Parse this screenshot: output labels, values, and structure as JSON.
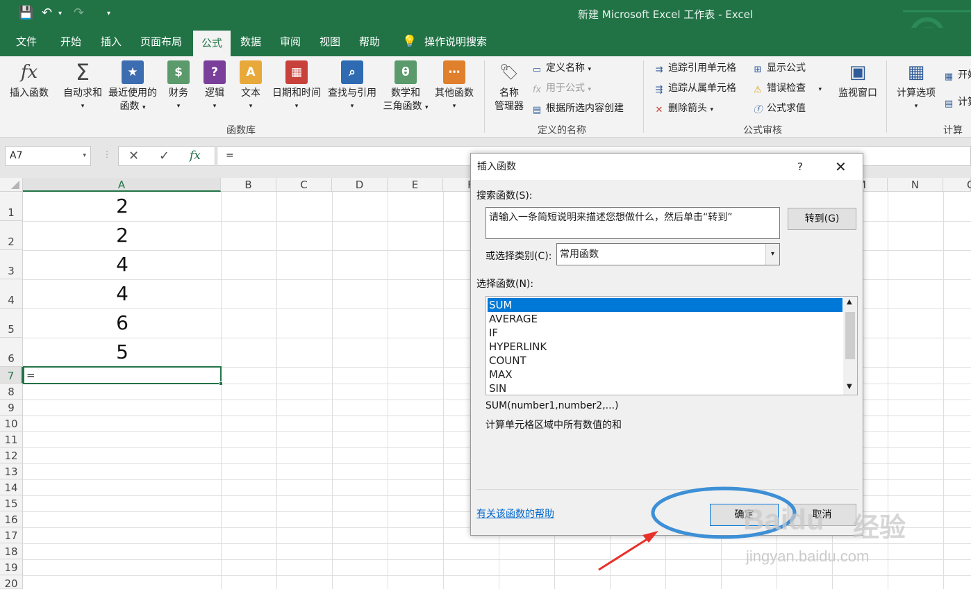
{
  "window": {
    "title": "新建 Microsoft Excel 工作表 - Excel"
  },
  "tabs": [
    "文件",
    "开始",
    "插入",
    "页面布局",
    "公式",
    "数据",
    "审阅",
    "视图",
    "帮助"
  ],
  "tell_me": "操作说明搜索",
  "ribbon": {
    "insert_function": "插入函数",
    "autosum": "自动求和",
    "recent": "最近使用的",
    "recent2": "函数",
    "financial": "财务",
    "logical": "逻辑",
    "text": "文本",
    "datetime": "日期和时间",
    "lookup": "查找与引用",
    "math": "数学和",
    "math2": "三角函数",
    "more": "其他函数",
    "group_library": "函数库",
    "name_mgr": "名称",
    "name_mgr2": "管理器",
    "define_name": "定义名称",
    "use_in_formula": "用于公式",
    "create_from_sel": "根据所选内容创建",
    "group_names": "定义的名称",
    "trace_precedents": "追踪引用单元格",
    "trace_dependents": "追踪从属单元格",
    "remove_arrows": "删除箭头",
    "show_formulas": "显示公式",
    "error_check": "错误检查",
    "evaluate": "公式求值",
    "watch": "监视窗口",
    "group_audit": "公式审核",
    "calc_options": "计算选项",
    "calc_now": "开始",
    "calc_sheet": "计算",
    "group_calc": "计算"
  },
  "formula_bar": {
    "name_box": "A7",
    "content": "="
  },
  "columns": [
    "A",
    "B",
    "C",
    "D",
    "E",
    "F",
    "M",
    "N",
    "O"
  ],
  "rows": [
    "1",
    "2",
    "3",
    "4",
    "5",
    "6",
    "7",
    "8",
    "9",
    "10",
    "11",
    "12",
    "13",
    "14",
    "15",
    "16",
    "17",
    "18",
    "19",
    "20"
  ],
  "cells": {
    "A1": "2",
    "A2": "2",
    "A3": "4",
    "A4": "4",
    "A5": "6",
    "A6": "5",
    "A7": "="
  },
  "dialog": {
    "title": "插入函数",
    "help": "?",
    "search_label": "搜索函数(S):",
    "search_text": "请输入一条简短说明来描述您想做什么，然后单击“转到”",
    "go_button": "转到(G)",
    "category_label": "或选择类别(C):",
    "category_value": "常用函数",
    "function_label": "选择函数(N):",
    "functions": [
      "SUM",
      "AVERAGE",
      "IF",
      "HYPERLINK",
      "COUNT",
      "MAX",
      "SIN"
    ],
    "signature": "SUM(number1,number2,...)",
    "description": "计算单元格区域中所有数值的和",
    "help_link": "有关该函数的帮助",
    "ok": "确定",
    "cancel": "取消"
  },
  "watermark": {
    "brand": "Baidu",
    "cn": "经验",
    "url": "jingyan.baidu.com"
  }
}
